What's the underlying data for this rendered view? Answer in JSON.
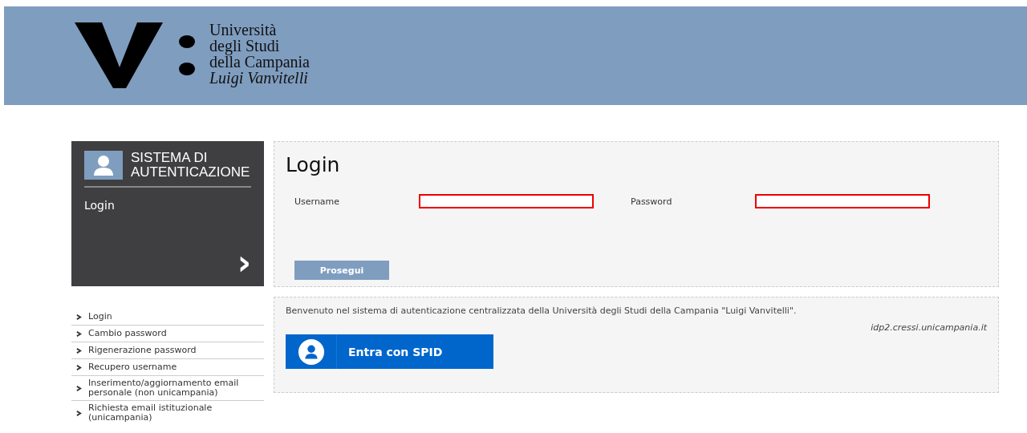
{
  "header": {
    "logo_lines": [
      "Università",
      "degli Studi",
      "della Campania"
    ],
    "logo_subtitle": "Luigi Vanvitelli"
  },
  "sidebar": {
    "title_lines": [
      "SISTEMA DI",
      "AUTENTICAZIONE"
    ],
    "current": "Login",
    "arrow": "›"
  },
  "nav": [
    {
      "label": "Login"
    },
    {
      "label": "Cambio password"
    },
    {
      "label": "Rigenerazione password"
    },
    {
      "label": "Recupero username"
    },
    {
      "label": "Inserimento/aggiornamento email personale (non unicampania)"
    },
    {
      "label": "Richiesta email istituzionale (unicampania)"
    }
  ],
  "login": {
    "title": "Login",
    "fields": [
      {
        "label": "Username",
        "highlighted": true
      },
      {
        "label": "Password",
        "highlighted": true
      }
    ],
    "submit": "Prosegui"
  },
  "welcome": {
    "text": "Benvenuto nel sistema di autenticazione centralizzata della Università degli Studi della Campania \"Luigi Vanvitelli\".",
    "host": "idp2.cressi.unicampania.it",
    "spid_button": "Entra con SPID"
  }
}
